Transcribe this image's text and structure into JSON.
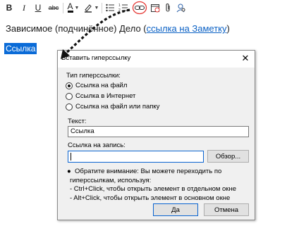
{
  "toolbar": {
    "bold": "B",
    "italic": "I",
    "underline": "U",
    "strike": "abc",
    "font_color": "A",
    "accent": "#e53935"
  },
  "document": {
    "title_prefix": "Зависимое (подчинённое) Дело (",
    "title_link": "ссылка на Заметку",
    "title_suffix": ")",
    "selected_text": "Ссылка"
  },
  "dialog": {
    "title": "Вставить гиперссылку",
    "close_label": "✕",
    "type_label": "Тип гиперссылки:",
    "options": [
      {
        "label": "Ссылка на файл",
        "checked": true
      },
      {
        "label": "Ссылка в Интернет",
        "checked": false
      },
      {
        "label": "Ссылка на файл или папку",
        "checked": false
      }
    ],
    "text_label": "Текст:",
    "text_value": "Ссылка",
    "link_label": "Ссылка на запись:",
    "link_value": "",
    "browse_label": "Обзор...",
    "note_line1": "●  Обратите внимание: Вы можете переходить по",
    "note_line2": "гиперссылкам, используя:",
    "note_line3": "- Ctrl+Click, чтобы открыть элемент в отдельном окне",
    "note_line4": "- Alt+Click, чтобы открыть элемент в основном окне",
    "ok_label": "Да",
    "cancel_label": "Отмена"
  }
}
